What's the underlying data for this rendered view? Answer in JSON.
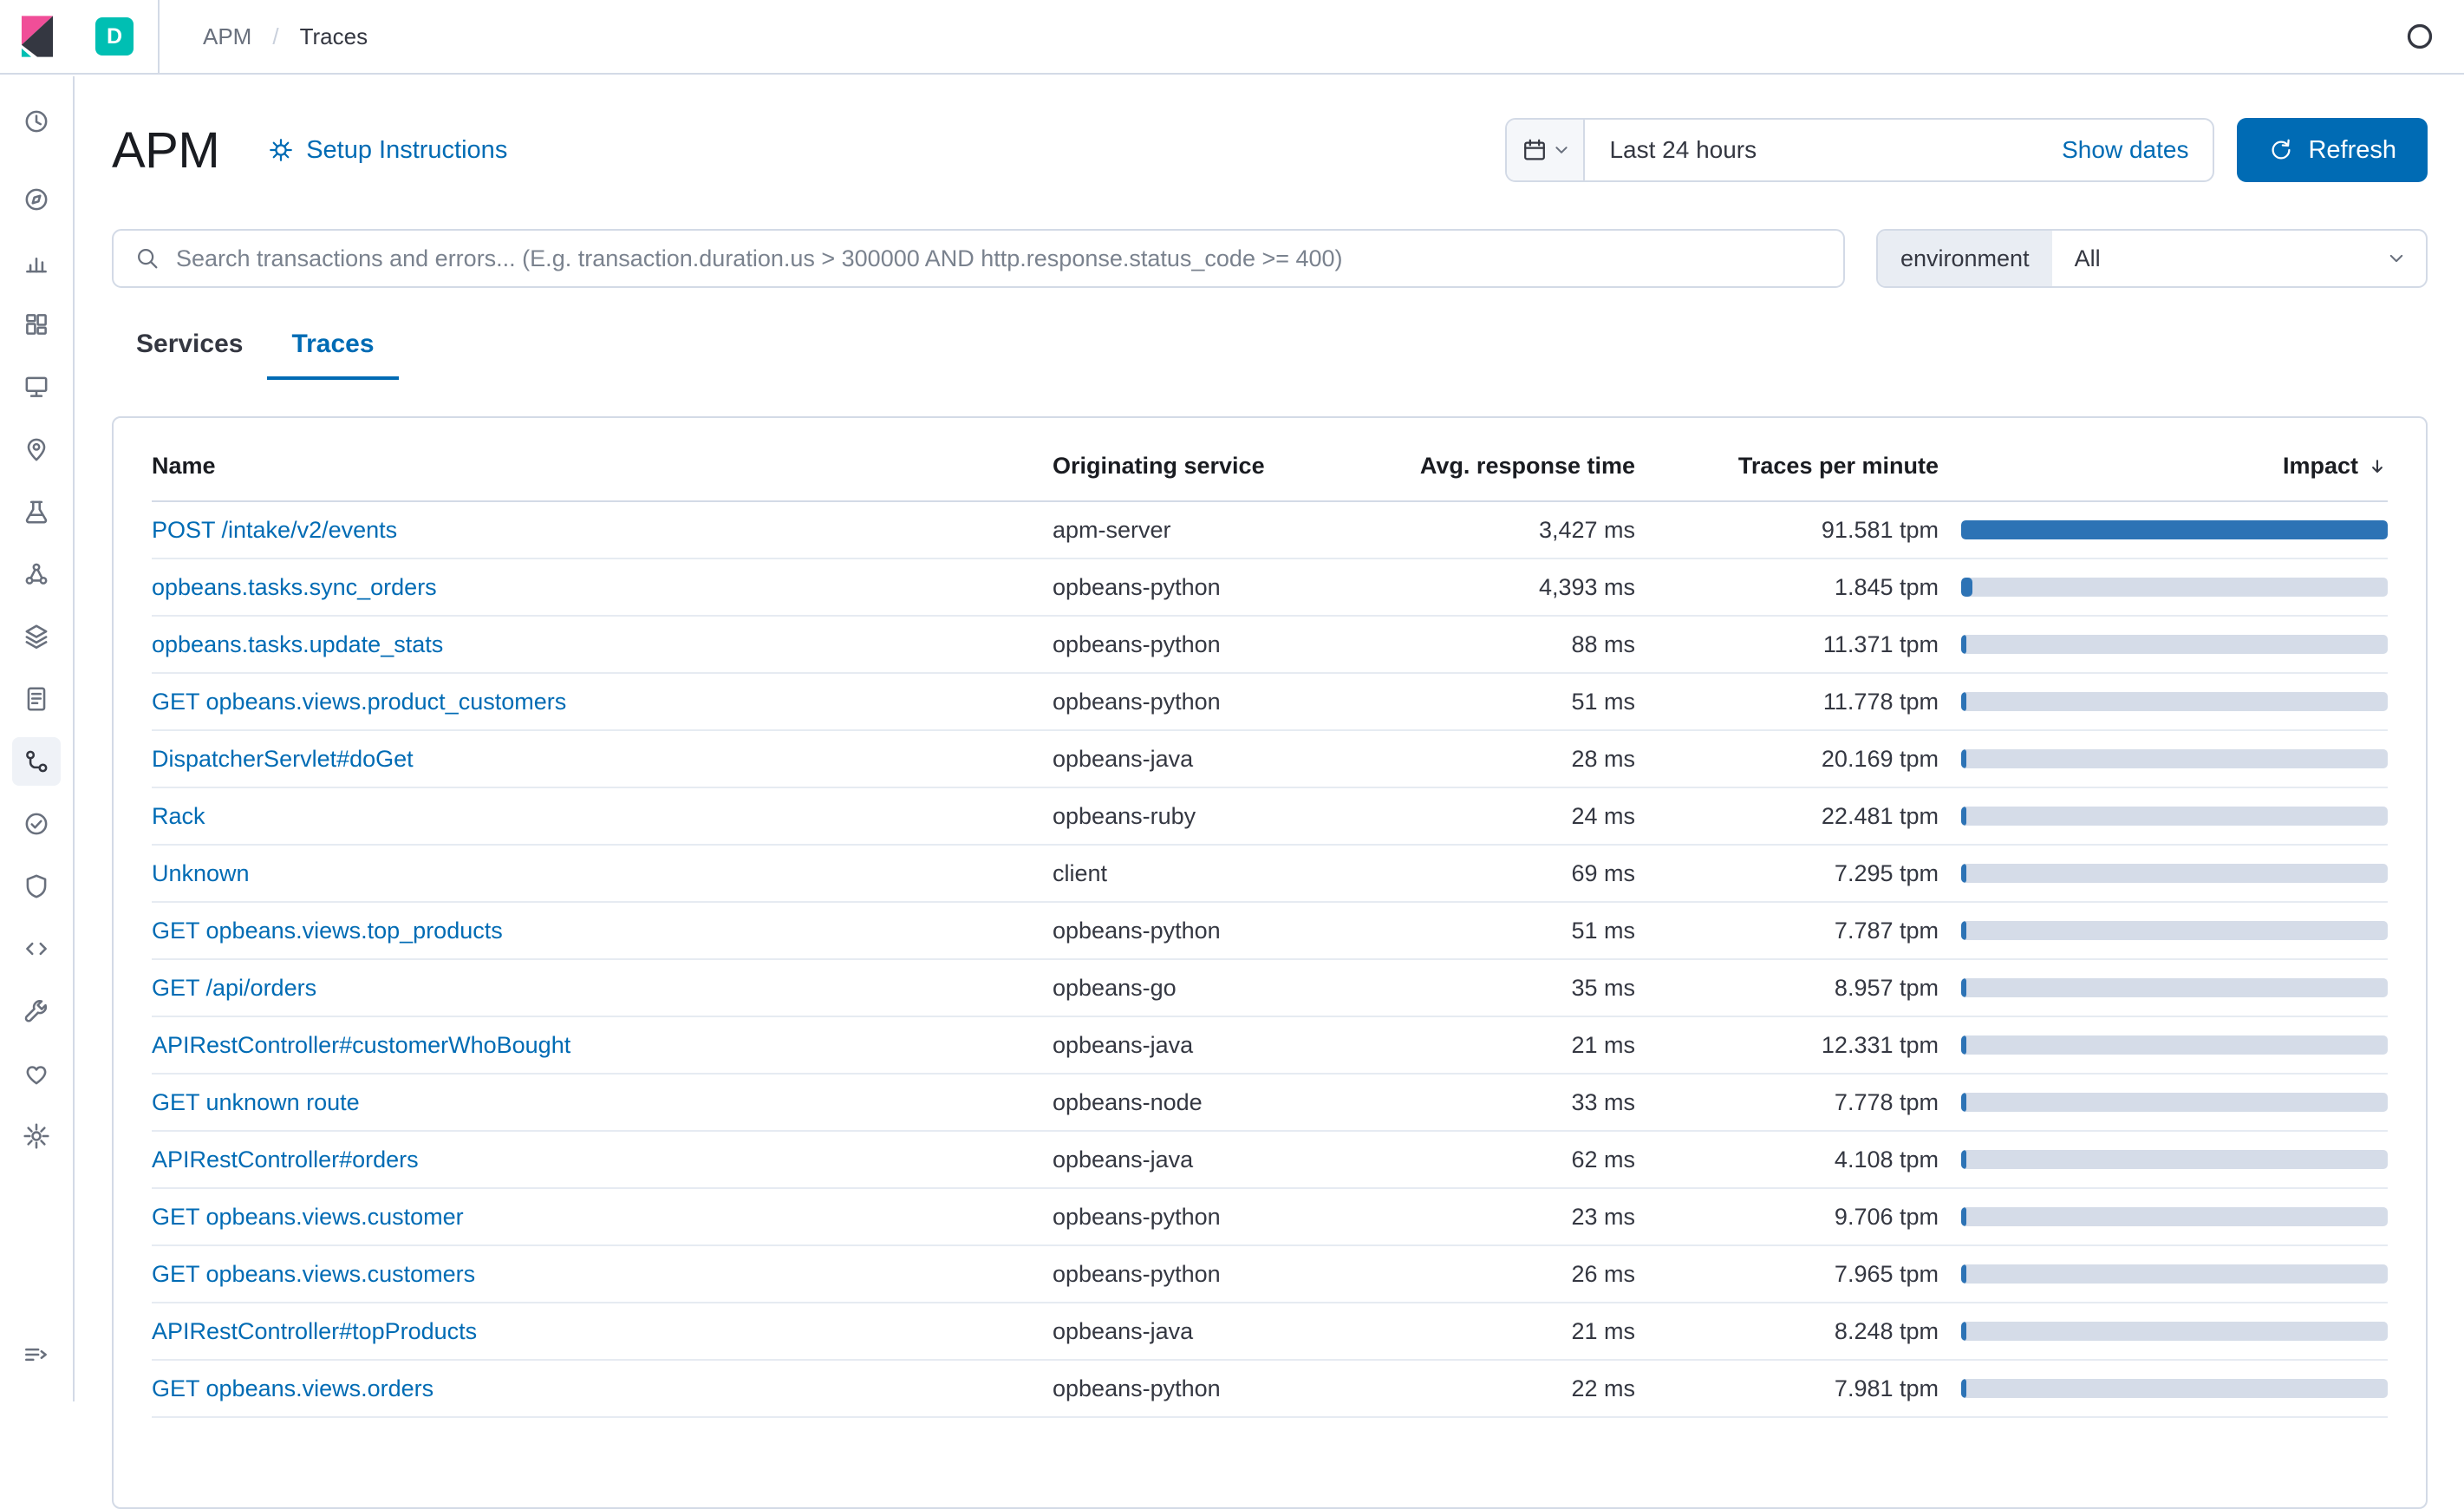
{
  "colors": {
    "primary_blue": "#006BB4",
    "impact_bar_fill": "#2D73B5",
    "impact_bar_track": "#D5DCE8",
    "avatar_teal": "#00BFB3",
    "logo_pink": "#F04E98",
    "logo_dark": "#343741",
    "logo_teal": "#00BFB3"
  },
  "header": {
    "space_initial": "D",
    "breadcrumbs": [
      "APM",
      "Traces"
    ],
    "separator": "/"
  },
  "sidebar": {
    "icons": [
      "recent",
      "discover",
      "visualize",
      "dashboard",
      "canvas",
      "maps",
      "machine-learning",
      "graph",
      "infrastructure",
      "logs",
      "apm",
      "uptime",
      "siem",
      "code",
      "dev-tools",
      "monitoring",
      "management",
      "collapse"
    ],
    "active": "apm"
  },
  "page": {
    "title": "APM",
    "setup_link": "Setup Instructions",
    "time": {
      "display": "Last 24 hours",
      "show_dates": "Show dates",
      "refresh": "Refresh"
    },
    "search_placeholder": "Search transactions and errors... (E.g. transaction.duration.us > 300000 AND http.response.status_code >= 400)",
    "environment": {
      "label": "environment",
      "value": "All"
    },
    "tabs": [
      {
        "label": "Services",
        "active": false
      },
      {
        "label": "Traces",
        "active": true
      }
    ]
  },
  "table": {
    "headers": {
      "name": "Name",
      "service": "Originating service",
      "avg": "Avg. response time",
      "tpm": "Traces per minute",
      "impact": "Impact"
    },
    "sort": {
      "column": "impact",
      "direction": "desc"
    },
    "rows": [
      {
        "name": "POST /intake/v2/events",
        "service": "apm-server",
        "avg": "3,427 ms",
        "tpm": "91.581 tpm",
        "impact_pct": 100
      },
      {
        "name": "opbeans.tasks.sync_orders",
        "service": "opbeans-python",
        "avg": "4,393 ms",
        "tpm": "1.845 tpm",
        "impact_pct": 2.6
      },
      {
        "name": "opbeans.tasks.update_stats",
        "service": "opbeans-python",
        "avg": "88 ms",
        "tpm": "11.371 tpm",
        "impact_pct": 0.4
      },
      {
        "name": "GET opbeans.views.product_customers",
        "service": "opbeans-python",
        "avg": "51 ms",
        "tpm": "11.778 tpm",
        "impact_pct": 0.3
      },
      {
        "name": "DispatcherServlet#doGet",
        "service": "opbeans-java",
        "avg": "28 ms",
        "tpm": "20.169 tpm",
        "impact_pct": 0.25
      },
      {
        "name": "Rack",
        "service": "opbeans-ruby",
        "avg": "24 ms",
        "tpm": "22.481 tpm",
        "impact_pct": 0.25
      },
      {
        "name": "Unknown",
        "service": "client",
        "avg": "69 ms",
        "tpm": "7.295 tpm",
        "impact_pct": 0.22
      },
      {
        "name": "GET opbeans.views.top_products",
        "service": "opbeans-python",
        "avg": "51 ms",
        "tpm": "7.787 tpm",
        "impact_pct": 0.18
      },
      {
        "name": "GET /api/orders",
        "service": "opbeans-go",
        "avg": "35 ms",
        "tpm": "8.957 tpm",
        "impact_pct": 0.14
      },
      {
        "name": "APIRestController#customerWhoBought",
        "service": "opbeans-java",
        "avg": "21 ms",
        "tpm": "12.331 tpm",
        "impact_pct": 0.11
      },
      {
        "name": "GET unknown route",
        "service": "opbeans-node",
        "avg": "33 ms",
        "tpm": "7.778 tpm",
        "impact_pct": 0.11
      },
      {
        "name": "APIRestController#orders",
        "service": "opbeans-java",
        "avg": "62 ms",
        "tpm": "4.108 tpm",
        "impact_pct": 0.11
      },
      {
        "name": "GET opbeans.views.customer",
        "service": "opbeans-python",
        "avg": "23 ms",
        "tpm": "9.706 tpm",
        "impact_pct": 0.09
      },
      {
        "name": "GET opbeans.views.customers",
        "service": "opbeans-python",
        "avg": "26 ms",
        "tpm": "7.965 tpm",
        "impact_pct": 0.08
      },
      {
        "name": "APIRestController#topProducts",
        "service": "opbeans-java",
        "avg": "21 ms",
        "tpm": "8.248 tpm",
        "impact_pct": 0.07
      },
      {
        "name": "GET opbeans.views.orders",
        "service": "opbeans-python",
        "avg": "22 ms",
        "tpm": "7.981 tpm",
        "impact_pct": 0.07
      }
    ]
  }
}
